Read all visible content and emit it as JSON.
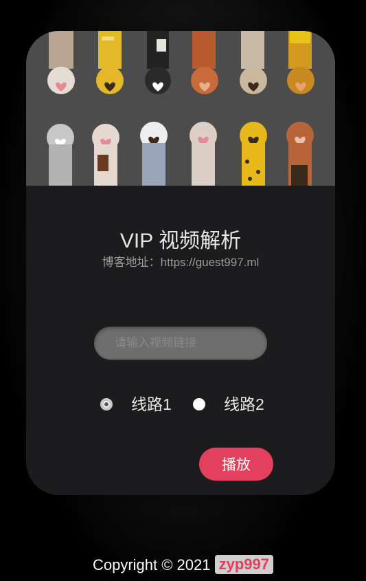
{
  "app": {
    "title": "VIP 视频解析",
    "subtitle": "博客地址：https://guest997.ml"
  },
  "banner": {
    "icon_name": "cat-paws-illustration"
  },
  "form": {
    "url_placeholder": "请输入视频链接",
    "url_value": "",
    "routes": [
      {
        "label": "线路1",
        "checked": true
      },
      {
        "label": "线路2",
        "checked": false
      }
    ],
    "play_label": "播放"
  },
  "footer": {
    "copyright": "Copyright © 2021",
    "author": "zyp997"
  },
  "colors": {
    "accent": "#e2405d",
    "card_bg": "#1c1c1e",
    "banner_bg": "#4a4a4a"
  }
}
